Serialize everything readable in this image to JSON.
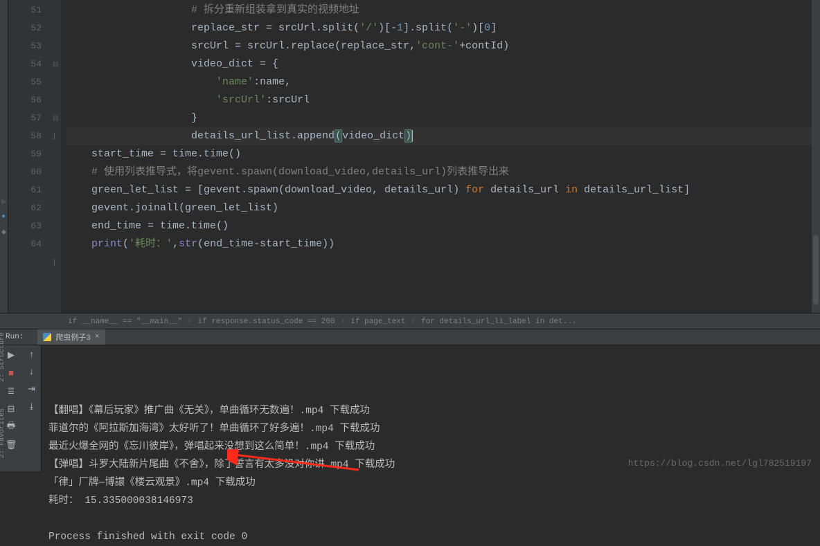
{
  "editor": {
    "lines": [
      {
        "n": 51,
        "type": "comment",
        "indent": "                    ",
        "text": "# 拆分重新组装拿到真实的视频地址"
      },
      {
        "n": 52,
        "indent": "                    ",
        "html": "replace_str = srcUrl.split(<span class='str'>'/'</span>)[-<span class='num'>1</span>].split(<span class='str'>'-'</span>)[<span class='num'>0</span>]"
      },
      {
        "n": 53,
        "indent": "                    ",
        "html": "srcUrl = srcUrl.replace(replace_str,<span class='str'>'cont-'</span>+contId)"
      },
      {
        "n": 54,
        "indent": "                    ",
        "html": "video_dict = {"
      },
      {
        "n": 55,
        "indent": "                        ",
        "html": "<span class='str'>'name'</span>:name,"
      },
      {
        "n": 56,
        "indent": "                        ",
        "html": "<span class='str'>'srcUrl'</span>:srcUrl"
      },
      {
        "n": 57,
        "indent": "                    ",
        "html": "}"
      },
      {
        "n": 58,
        "highlighted": true,
        "indent": "                    ",
        "html": "details_url_list.append<span class='paren-match'>(</span>video_dict<span class='paren-match'>)</span><span class='caret'></span>"
      },
      {
        "n": 59,
        "indent": "    ",
        "html": "start_time = time.time()"
      },
      {
        "n": 60,
        "type": "comment",
        "indent": "    ",
        "text": "# 使用列表推导式，将gevent.spawn(download_video,details_url)列表推导出来"
      },
      {
        "n": 61,
        "indent": "    ",
        "html": "green_let_list = [gevent.spawn(download_video, details_url) <span class='kw'>for</span> details_url <span class='kw'>in</span> details_url_list]"
      },
      {
        "n": 62,
        "indent": "    ",
        "html": "gevent.joinall(green_let_list)"
      },
      {
        "n": 63,
        "indent": "    ",
        "html": "end_time = time.time()"
      },
      {
        "n": 64,
        "indent": "    ",
        "html": "<span class='builtin'>print</span>(<span class='str'>'耗时：'</span>,<span class='builtin'>str</span>(end_time-start_time))"
      }
    ]
  },
  "breadcrumb": {
    "items": [
      "if __name__ == \"__main__\"",
      "if response.status_code == 200",
      "if page_text",
      "for details_url_li_label in det..."
    ]
  },
  "run_panel": {
    "label": "Run:",
    "tab_name": "爬虫例子3",
    "output": [
      "【翻唱】《幕后玩家》推广曲《无关》，单曲循环无数遍！.mp4 下载成功",
      "菲道尔的《阿拉斯加海湾》太好听了！单曲循环了好多遍！.mp4 下载成功",
      "最近火爆全网的《忘川彼岸》，弹唱起来没想到这么简单！.mp4 下载成功",
      "【弹唱】斗罗大陆新片尾曲《不舍》，除了誓言有太多没对你讲.mp4 下载成功",
      "「律」厂牌—博譞《楼云观景》.mp4 下载成功",
      "耗时： 15.335000038146973",
      "",
      "Process finished with exit code 0"
    ]
  },
  "side_labels": {
    "structure": "2: Structure",
    "favorites": "2: Favorites"
  },
  "watermark": "https://blog.csdn.net/lgl782519197"
}
